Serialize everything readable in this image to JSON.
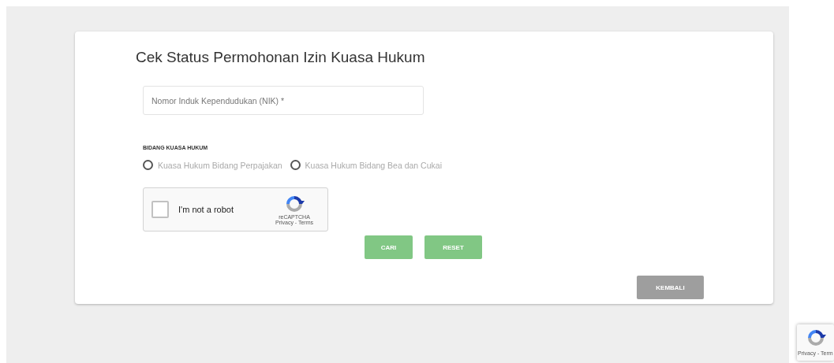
{
  "form": {
    "title": "Cek Status Permohonan Izin Kuasa Hukum",
    "nik_field": {
      "placeholder": "Nomor Induk Kependudukan (NIK) *"
    },
    "bidang": {
      "label": "BIDANG KUASA HUKUM",
      "options": [
        {
          "label": "Kuasa Hukum Bidang Perpajakan",
          "selected": false
        },
        {
          "label": "Kuasa Hukum Bidang Bea dan Cukai",
          "selected": false
        }
      ]
    },
    "captcha": {
      "label": "I'm not a robot",
      "checked": false,
      "brand": "reCAPTCHA",
      "links": "Privacy - Terms"
    },
    "buttons": [
      {
        "label": "CARI",
        "kind": "primary"
      },
      {
        "label": "RESET",
        "kind": "primary"
      }
    ],
    "back_button": {
      "label": "KEMBALI",
      "kind": "secondary"
    }
  },
  "recaptcha_badge": {
    "text": "Privacy - Term"
  }
}
